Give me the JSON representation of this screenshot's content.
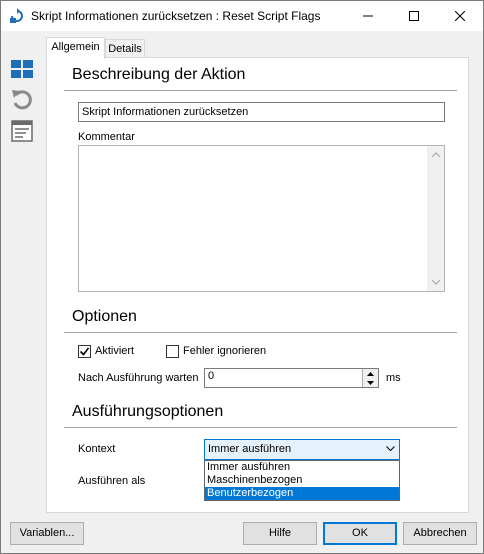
{
  "window": {
    "title": "Skript Informationen zurücksetzen : Reset Script Flags"
  },
  "tabs": [
    {
      "label": "Allgemein"
    },
    {
      "label": "Details"
    }
  ],
  "sections": {
    "description": {
      "title": "Beschreibung der Aktion",
      "name_value": "Skript Informationen zurücksetzen",
      "comment_label": "Kommentar",
      "comment_value": ""
    },
    "options": {
      "title": "Optionen",
      "activated_label": "Aktiviert",
      "activated_checked": true,
      "ignore_errors_label": "Fehler ignorieren",
      "ignore_errors_checked": false,
      "wait_label": "Nach Ausführung warten",
      "wait_value": "0",
      "wait_unit": "ms"
    },
    "execution": {
      "title": "Ausführungsoptionen",
      "context_label": "Kontext",
      "context_value": "Immer ausführen",
      "context_options": [
        "Immer ausführen",
        "Maschinenbezogen",
        "Benutzerbezogen"
      ],
      "highlighted_option": "Benutzerbezogen",
      "run_as_label": "Ausführen als"
    }
  },
  "buttons": {
    "variables": "Variablen...",
    "help": "Hilfe",
    "ok": "OK",
    "cancel": "Abbrechen"
  },
  "colors": {
    "accent": "#0078d7",
    "icon_blue": "#1c6fb8",
    "icon_gray": "#8a8a8a"
  },
  "icons": {
    "app": "refresh-arrow-icon",
    "strip": [
      "grid-icon",
      "undo-icon",
      "list-icon"
    ]
  }
}
